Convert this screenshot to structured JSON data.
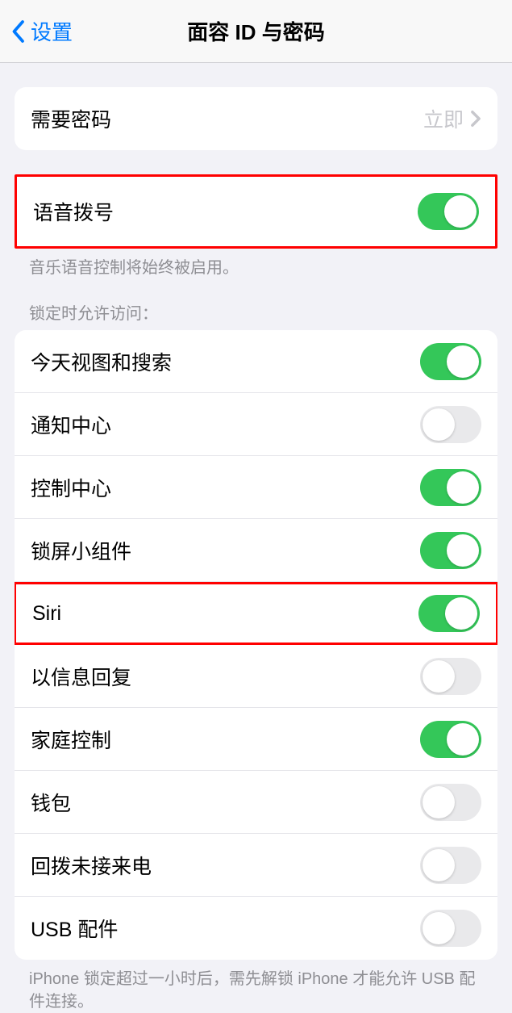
{
  "nav": {
    "back_label": "设置",
    "title": "面容 ID 与密码"
  },
  "passcode_row": {
    "label": "需要密码",
    "value": "立即"
  },
  "voice_dial": {
    "label": "语音拨号",
    "footer": "音乐语音控制将始终被启用。",
    "enabled": true
  },
  "lock_section": {
    "header": "锁定时允许访问：",
    "items": [
      {
        "label": "今天视图和搜索",
        "enabled": true
      },
      {
        "label": "通知中心",
        "enabled": false
      },
      {
        "label": "控制中心",
        "enabled": true
      },
      {
        "label": "锁屏小组件",
        "enabled": true
      },
      {
        "label": "Siri",
        "enabled": true,
        "highlighted": true
      },
      {
        "label": "以信息回复",
        "enabled": false
      },
      {
        "label": "家庭控制",
        "enabled": true
      },
      {
        "label": "钱包",
        "enabled": false
      },
      {
        "label": "回拨未接来电",
        "enabled": false
      },
      {
        "label": "USB 配件",
        "enabled": false
      }
    ],
    "footer": "iPhone 锁定超过一小时后，需先解锁 iPhone 才能允许 USB 配件连接。"
  }
}
